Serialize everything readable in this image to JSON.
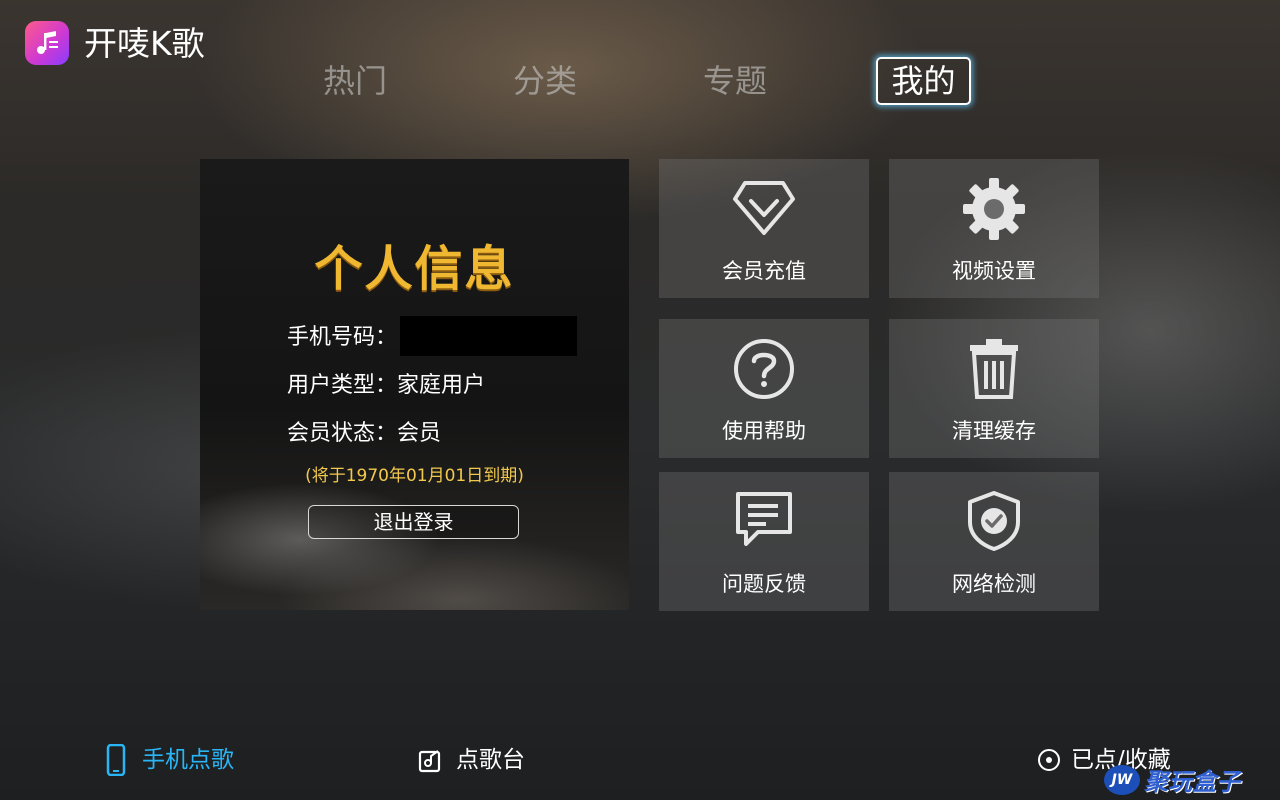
{
  "app": {
    "title": "开唛K歌"
  },
  "nav": {
    "tabs": [
      {
        "label": "热门"
      },
      {
        "label": "分类"
      },
      {
        "label": "专题"
      },
      {
        "label": "我的"
      }
    ],
    "active": "我的"
  },
  "profile": {
    "title": "个人信息",
    "phone_label": "手机号码：",
    "user_type_label": "用户类型：",
    "user_type_value": "家庭用户",
    "vip_status_label": "会员状态：",
    "vip_status_value": "会员",
    "expiry": "(将于1970年01月01日到期)",
    "logout_label": "退出登录"
  },
  "tiles": [
    {
      "label": "会员充值",
      "icon": "diamond-icon"
    },
    {
      "label": "视频设置",
      "icon": "gear-icon"
    },
    {
      "label": "使用帮助",
      "icon": "help-icon"
    },
    {
      "label": "清理缓存",
      "icon": "trash-icon"
    },
    {
      "label": "问题反馈",
      "icon": "feedback-icon"
    },
    {
      "label": "网络检测",
      "icon": "shield-check-icon"
    }
  ],
  "bottom_bar": {
    "phone_song": "手机点歌",
    "song_station": "点歌台",
    "ordered_favorites": "已点/收藏"
  },
  "watermark": {
    "badge": "JW",
    "text": "聚玩盒子"
  },
  "colors": {
    "accent_blue": "#29b6f6",
    "gold": "#f0b830",
    "expiry_yellow": "#f2c94c"
  }
}
